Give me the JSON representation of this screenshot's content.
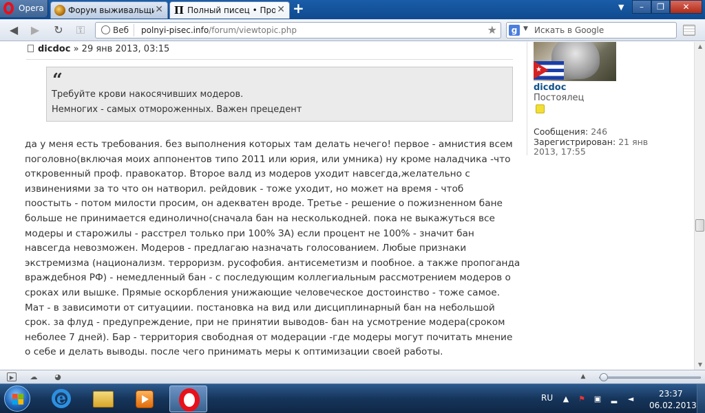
{
  "browser": {
    "app_button_label": "Opera",
    "tabs": [
      {
        "label": "Форум выживальщик...",
        "active": false
      },
      {
        "label": "Полный писец • Прос...",
        "active": true
      }
    ],
    "new_tab_label": "+",
    "window_controls": {
      "minimize": "–",
      "restore": "❐",
      "close": "✕"
    }
  },
  "address_bar": {
    "security_badge": "Веб",
    "url_domain": "polnyi-pisec.info",
    "url_path": "/forum/viewtopic.php",
    "search_engine": "g",
    "search_placeholder": "Искать в Google"
  },
  "post": {
    "author": "dicdoc",
    "separator": "»",
    "date": "29 янв 2013, 03:15",
    "quote": {
      "mark": "“",
      "lines": [
        "Требуйте крови накосячивших модеров.",
        "Немногих - самых отмороженных. Важен прецедент"
      ]
    },
    "body_lines": [
      "да у меня есть требования. без выполнения которых там делать нечего! первое - амнистия всем",
      "поголовно(включая моих аппонентов типо 2011 или юрия, или умника) ну кроме наладчика -что",
      "откровенный проф. правокатор. Второе валд из модеров уходит навсегда,желательно с",
      "извинениями за то что он натворил. рейдовик - тоже уходит, но может на время - чтоб",
      "поостыть - потом милости просим, он адекватен вроде. Третье - решение о пожизненном бане",
      "больше не принимается единолично(сначала бан на несколькодней. пока не выкажуться все",
      "модеры и старожилы - расстрел только при 100% ЗА) если процент не 100% - значит бан",
      "навсегда невозможен. Модеров - предлагаю назначать голосованием. Любые признаки",
      "экстремизма (национализм. терроризм. русофобия. антисеметизм и пообное. а также пропоганда",
      "враждебноя РФ) - немедленный бан - с последующим коллегиальным рассмотрением модеров о",
      "сроках или вышке. Прямые оскорбления унижающие человеческое достоинство - тоже самое.",
      "Мат - в зависимоти от ситуациии. постановка на вид или дисциплинарный бан на небольшой",
      "срок. за флуд - предупреждение, при не принятии выводов- бан на усмотрение модера(сроком",
      "неболее 7 дней). Бар - территория свободная от модерации -где модеры могут почитать мнение",
      "о себе и делать выводы. после чего принимать меры к оптимизации своей работы."
    ]
  },
  "profile": {
    "name": "dicdoc",
    "rank": "Постоялец",
    "posts_label": "Сообщения:",
    "posts_value": "246",
    "registered_label": "Зарегистрирован:",
    "registered_value_1": "21 янв",
    "registered_value_2": "2013, 17:55"
  },
  "taskbar": {
    "language": "RU",
    "time": "23:37",
    "date": "06.02.2013"
  },
  "icons": {
    "back": "back-arrow-icon",
    "forward": "forward-arrow-icon",
    "reload": "reload-icon",
    "key": "key-icon",
    "star": "bookmark-star-icon",
    "rss": "rss-feed-icon"
  },
  "colors": {
    "tabbar": "#1a5da8",
    "author_link": "#105289",
    "opera_red": "#e8101a",
    "quote_bg": "#ebebeb",
    "rank_badge": "#f1df36",
    "taskbar": "#16355b"
  }
}
